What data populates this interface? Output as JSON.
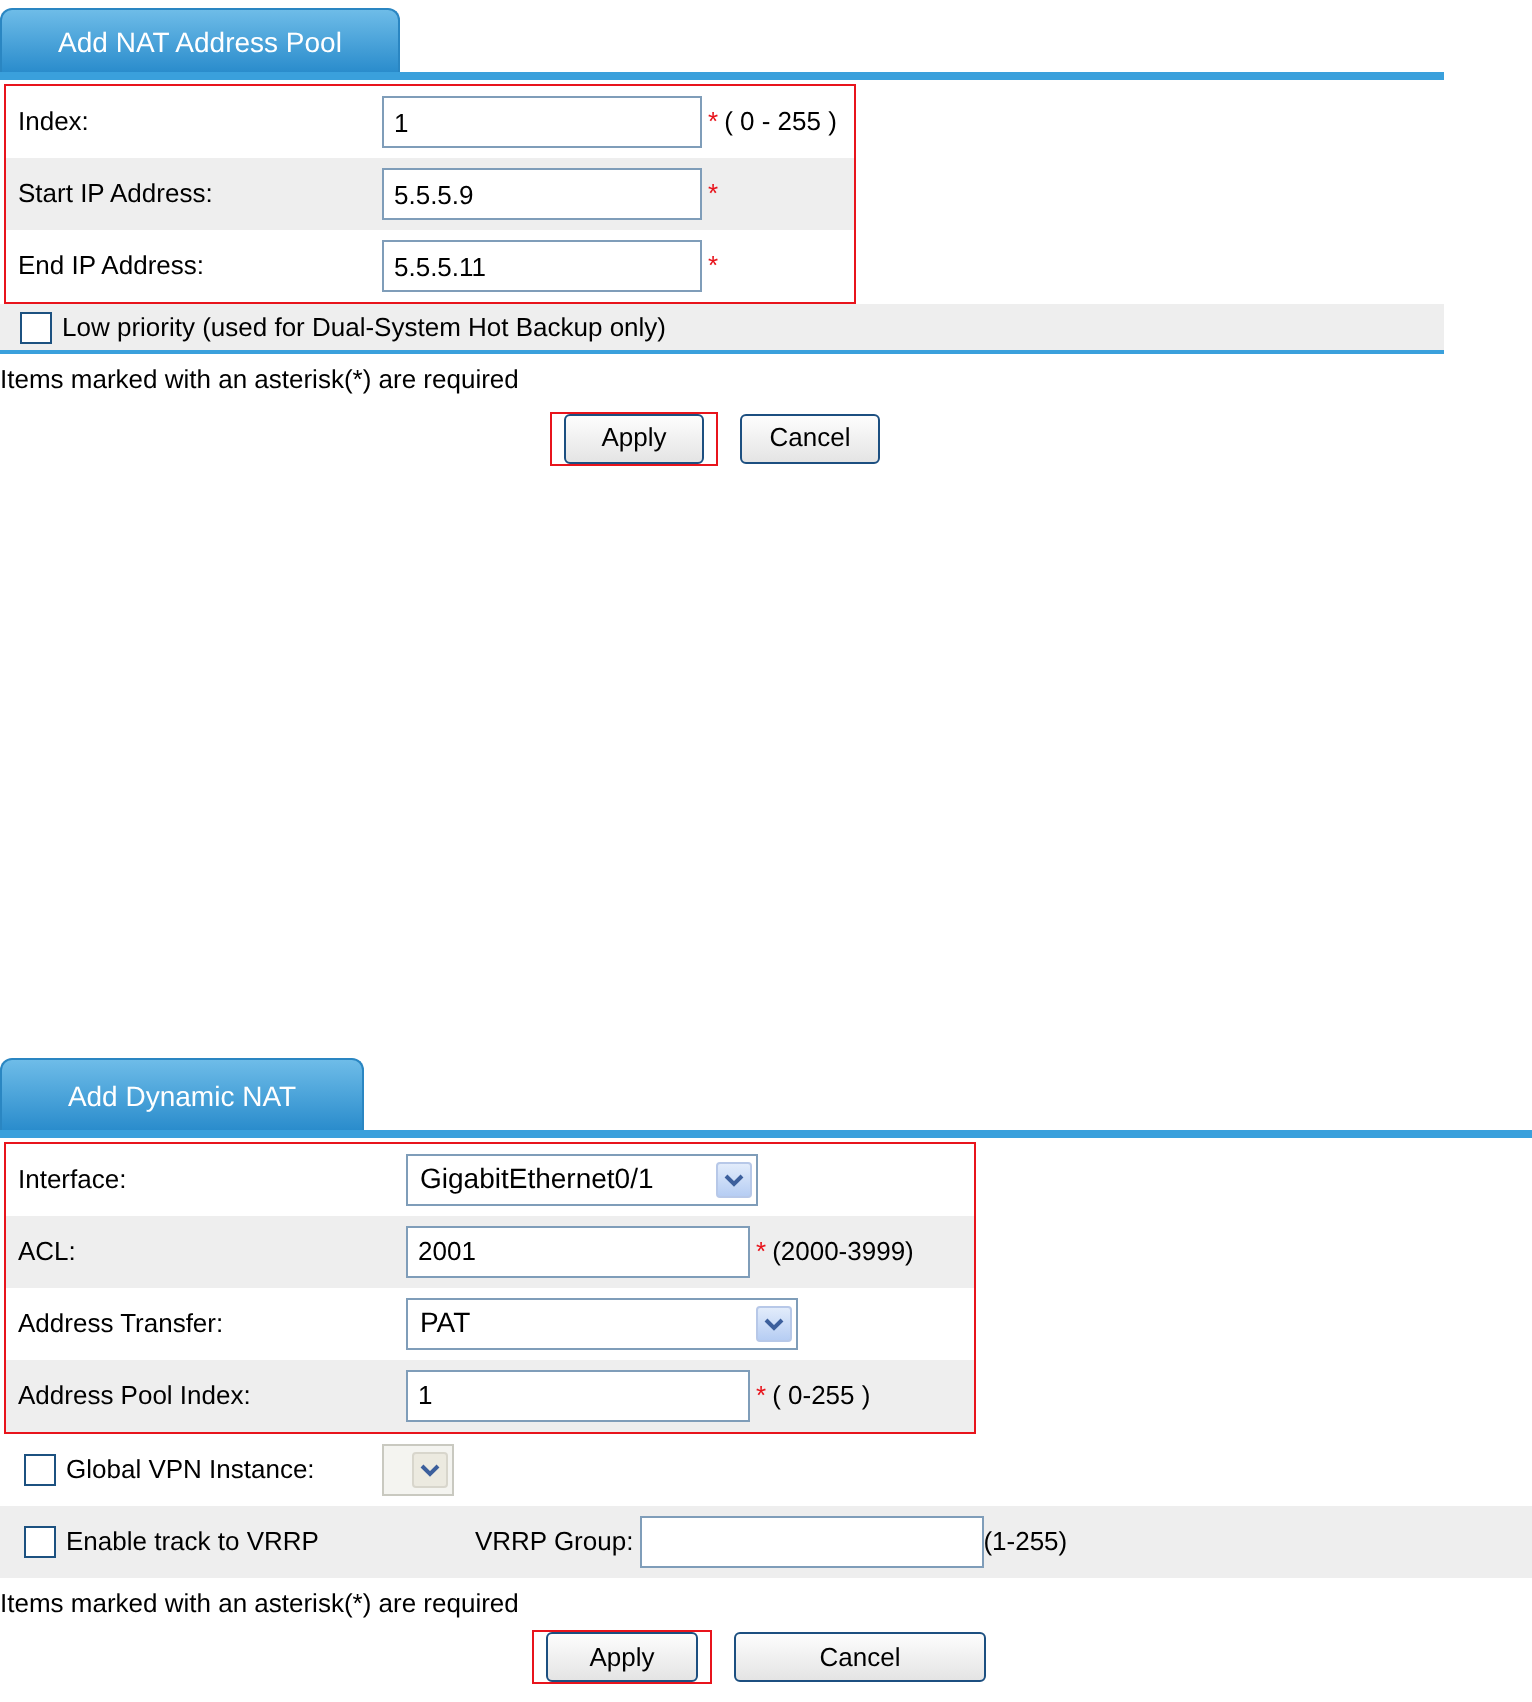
{
  "panels": [
    {
      "tab": "Add NAT Address Pool",
      "highlighted": true,
      "rows": [
        {
          "label": "Index:",
          "kind": "text",
          "value": "1",
          "asterisk": "*",
          "hint": "( 0 - 255 )"
        },
        {
          "label": "Start IP Address:",
          "kind": "text",
          "value": "5.5.5.9",
          "asterisk": "*"
        },
        {
          "label": "End IP Address:",
          "kind": "text",
          "value": "5.5.5.11",
          "asterisk": "*"
        }
      ],
      "options": [
        {
          "kind": "centered",
          "checked": false,
          "label": "Low priority (used for Dual-System Hot Backup only)"
        }
      ],
      "note": "Items marked with an asterisk(*) are required",
      "buttons": [
        {
          "label": "Apply",
          "highlighted": true
        },
        {
          "label": "Cancel",
          "highlighted": false
        }
      ]
    },
    {
      "tab": "Add Dynamic NAT",
      "highlighted": true,
      "rows": [
        {
          "label": "Interface:",
          "kind": "select",
          "value": "GigabitEthernet0/1"
        },
        {
          "label": "ACL:",
          "kind": "text",
          "value": "2001",
          "asterisk": "*",
          "hint": "(2000-3999)"
        },
        {
          "label": "Address Transfer:",
          "kind": "select",
          "value": "PAT"
        },
        {
          "label": "Address Pool Index:",
          "kind": "text",
          "value": "1",
          "asterisk": "*",
          "hint": "( 0-255 )"
        }
      ],
      "options": [
        {
          "kind": "select",
          "checked": false,
          "label": "Global VPN Instance:",
          "disabled": true
        },
        {
          "kind": "field",
          "checked": false,
          "label": "Enable track to VRRP",
          "field_label": "VRRP Group:",
          "hint": "(1-255)"
        }
      ],
      "note": "Items marked with an asterisk(*) are required",
      "buttons": [
        {
          "label": "Apply",
          "highlighted": true
        },
        {
          "label": "Cancel",
          "highlighted": false
        }
      ]
    }
  ]
}
